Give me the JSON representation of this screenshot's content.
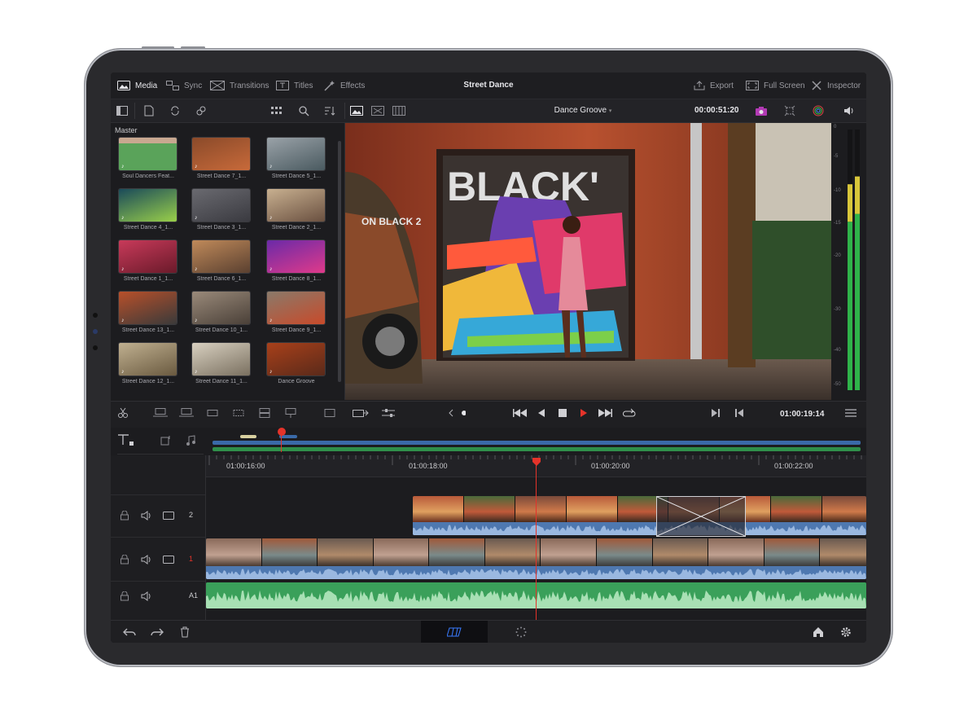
{
  "top_bar": {
    "title": "Street Dance",
    "pages": [
      {
        "label": "Media",
        "icon": "media-icon",
        "active": true
      },
      {
        "label": "Sync",
        "icon": "sync-icon",
        "active": false
      },
      {
        "label": "Transitions",
        "icon": "transitions-icon",
        "active": false
      },
      {
        "label": "Titles",
        "icon": "titles-icon",
        "active": false
      },
      {
        "label": "Effects",
        "icon": "effects-icon",
        "active": false
      }
    ],
    "right_actions": [
      {
        "label": "Export",
        "icon": "export-icon"
      },
      {
        "label": "Full Screen",
        "icon": "full-screen-icon"
      },
      {
        "label": "Inspector",
        "icon": "inspector-icon"
      }
    ]
  },
  "viewer": {
    "clip_name": "Dance Groove",
    "source_timecode": "00:00:51:20",
    "record_timecode": "01:00:19:14"
  },
  "media_pool": {
    "bin_name": "Master",
    "clips": [
      {
        "label": "Soul Dancers Feat..."
      },
      {
        "label": "Street Dance 7_1..."
      },
      {
        "label": "Street Dance 5_1..."
      },
      {
        "label": "Street Dance 4_1..."
      },
      {
        "label": "Street Dance 3_1..."
      },
      {
        "label": "Street Dance 2_1..."
      },
      {
        "label": "Street Dance 1_1..."
      },
      {
        "label": "Street Dance 6_1..."
      },
      {
        "label": "Street Dance 8_1..."
      },
      {
        "label": "Street Dance 13_1..."
      },
      {
        "label": "Street Dance 10_1..."
      },
      {
        "label": "Street Dance 9_1..."
      },
      {
        "label": "Street Dance 12_1..."
      },
      {
        "label": "Street Dance 11_1..."
      },
      {
        "label": "Dance Groove"
      }
    ]
  },
  "audio_meter": {
    "scale": [
      "0",
      "-5",
      "-10",
      "-15",
      "-20",
      "-30",
      "-40",
      "-50"
    ],
    "left_level": 0.79,
    "right_level": 0.82
  },
  "timeline": {
    "ruler": [
      "01:00:16:00",
      "01:00:18:00",
      "01:00:20:00",
      "01:00:22:00"
    ],
    "tracks": [
      {
        "label": "2",
        "type": "video"
      },
      {
        "label": "1",
        "type": "video"
      },
      {
        "label": "A1",
        "type": "audio"
      }
    ]
  },
  "colors": {
    "accent_red": "#e5332a",
    "audio_green": "#3aa05a",
    "clip_blue": "#4e78b0",
    "meter_green": "#2fb34a",
    "meter_yellow": "#d8c63a"
  }
}
